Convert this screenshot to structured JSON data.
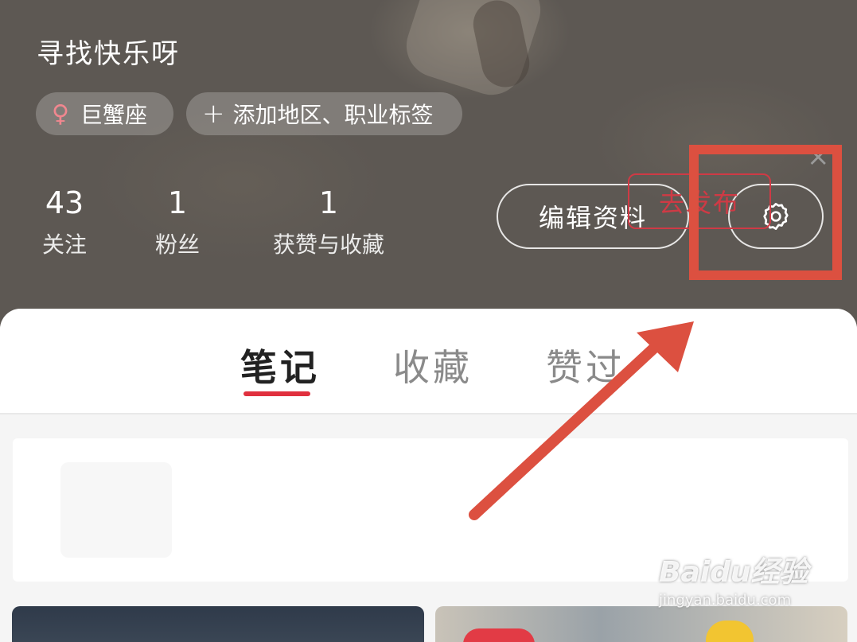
{
  "profile": {
    "username": "寻找快乐呀",
    "tags": {
      "zodiac_symbol": "♀",
      "zodiac": "巨蟹座",
      "add_symbol": "+",
      "add_label": "添加地区、职业标签"
    },
    "stats": [
      {
        "value": "43",
        "label": "关注"
      },
      {
        "value": "1",
        "label": "粉丝"
      },
      {
        "value": "1",
        "label": "获赞与收藏"
      }
    ],
    "edit_label": "编辑资料",
    "settings_icon": "gear-icon"
  },
  "tabs": [
    {
      "label": "笔记",
      "active": true
    },
    {
      "label": "收藏",
      "active": false
    },
    {
      "label": "赞过",
      "active": false
    }
  ],
  "prompt_card": {
    "close_symbol": "×",
    "publish_label": "去发布"
  },
  "watermark": {
    "logo": "Baidu经验",
    "url": "jingyan.baidu.com"
  },
  "colors": {
    "annotation_red": "#dc5040",
    "accent_red": "#e0303e",
    "header_bg": "#5d5853"
  }
}
